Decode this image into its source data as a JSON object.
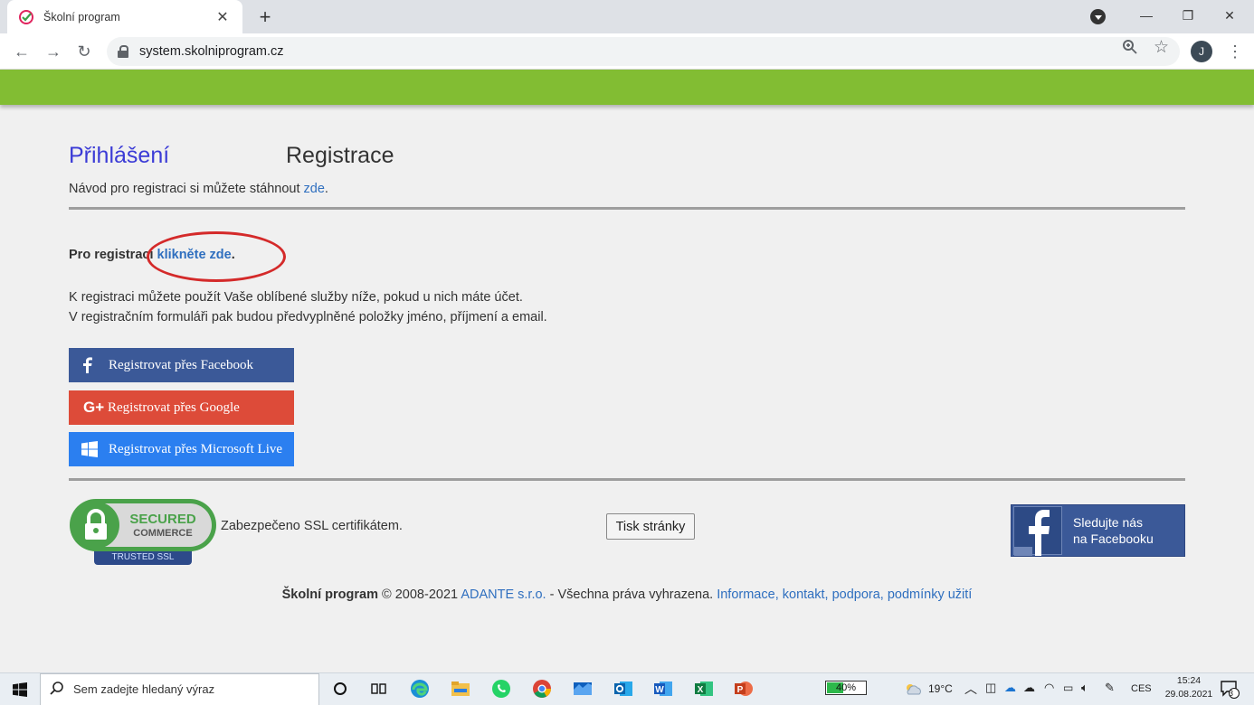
{
  "browser": {
    "tab_title": "Školní program",
    "url": "system.skolniprogram.cz",
    "avatar_letter": "J"
  },
  "page": {
    "tab_login": "Přihlášení",
    "tab_register": "Registrace",
    "guide_prefix": "Návod pro registraci si můžete stáhnout ",
    "guide_link": "zde",
    "guide_suffix": ".",
    "reg_prefix": "Pro registraci ",
    "reg_link": "klikněte zde",
    "reg_suffix": ".",
    "info_line1": "K registraci můžete použít Vaše oblíbené služby níže, pokud u nich máte účet.",
    "info_line2": "V registračním formuláři pak budou předvyplněné položky jméno, příjmení a email.",
    "btn_facebook": "Registrovat přes Facebook",
    "btn_google": "Registrovat přes Google",
    "btn_microsoft": "Registrovat přes Microsoft Live",
    "ssl_badge_line1": "SECURED",
    "ssl_badge_line2": "COMMERCE",
    "ssl_badge_line3": "TRUSTED SSL",
    "ssl_text": "Zabezpečeno SSL certifikátem.",
    "print_button": "Tisk stránky",
    "fb_follow_line1": "Sledujte nás",
    "fb_follow_line2": "na Facebooku",
    "footer_brand": "Školní program",
    "footer_copy": " © 2008-2021 ",
    "footer_company": "ADANTE s.r.o.",
    "footer_rights": " - Všechna práva vyhrazena. ",
    "footer_link1": "Informace",
    "footer_link2": "kontakt",
    "footer_link3": "podpora",
    "footer_link4": "podmínky užití"
  },
  "colors": {
    "green_bar": "#82bd33",
    "facebook": "#3b5998",
    "google": "#dd4b39",
    "microsoft": "#2b7ff0",
    "highlight_circle": "#d42a2a"
  },
  "taskbar": {
    "search_placeholder": "Sem zadejte hledaný výraz",
    "battery_percent": "40%",
    "battery_level": 0.4,
    "temperature": "19°C",
    "language": "CES",
    "time": "15:24",
    "date": "29.08.2021",
    "notification_count": "3"
  }
}
